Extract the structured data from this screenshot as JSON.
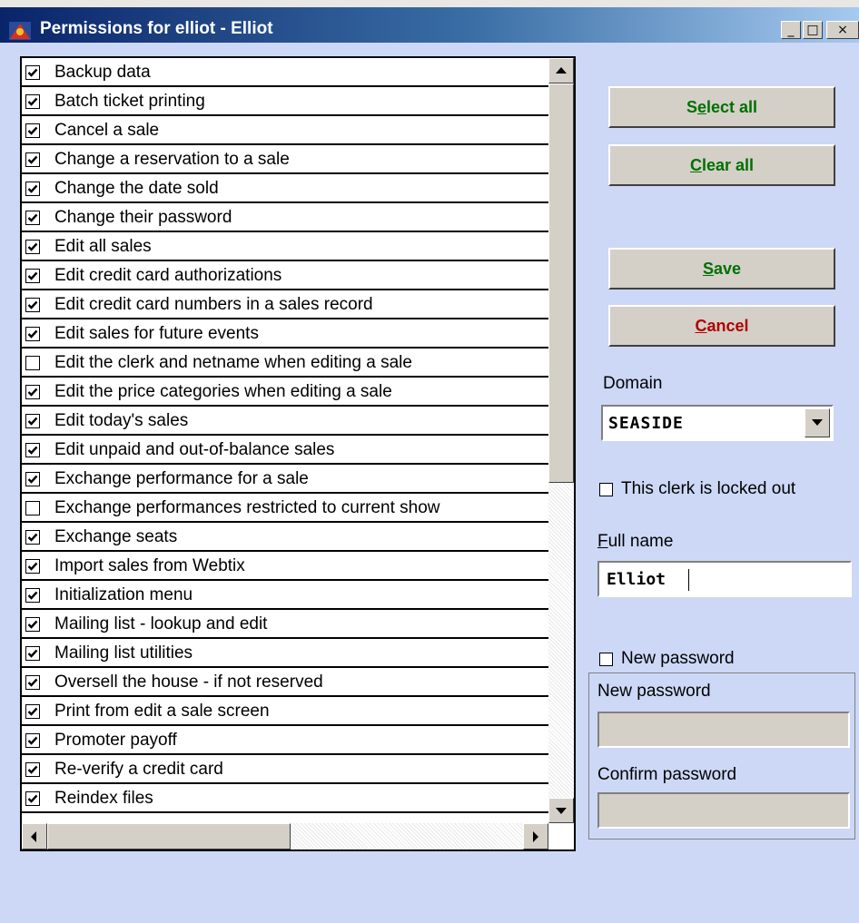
{
  "window": {
    "title": "Permissions for elliot - Elliot",
    "minimize_glyph": "_",
    "maximize_glyph": "□",
    "close_glyph": "×"
  },
  "permissions": [
    {
      "label": "Backup data",
      "checked": true
    },
    {
      "label": "Batch ticket printing",
      "checked": true
    },
    {
      "label": "Cancel a sale",
      "checked": true
    },
    {
      "label": "Change a reservation to a sale",
      "checked": true
    },
    {
      "label": "Change the date sold",
      "checked": true
    },
    {
      "label": "Change their password",
      "checked": true
    },
    {
      "label": "Edit all sales",
      "checked": true
    },
    {
      "label": "Edit credit card authorizations",
      "checked": true
    },
    {
      "label": "Edit credit card numbers in a sales record",
      "checked": true
    },
    {
      "label": "Edit sales for future events",
      "checked": true
    },
    {
      "label": "Edit the clerk and netname when editing a sale",
      "checked": false
    },
    {
      "label": "Edit the price categories when editing a sale",
      "checked": true
    },
    {
      "label": "Edit today's sales",
      "checked": true
    },
    {
      "label": "Edit unpaid and out-of-balance sales",
      "checked": true
    },
    {
      "label": "Exchange performance for a sale",
      "checked": true
    },
    {
      "label": "Exchange performances restricted to current show",
      "checked": false
    },
    {
      "label": "Exchange seats",
      "checked": true
    },
    {
      "label": "Import sales from Webtix",
      "checked": true
    },
    {
      "label": "Initialization menu",
      "checked": true
    },
    {
      "label": "Mailing list - lookup and edit",
      "checked": true
    },
    {
      "label": "Mailing list utilities",
      "checked": true
    },
    {
      "label": "Oversell the house - if not reserved",
      "checked": true
    },
    {
      "label": "Print from edit a sale screen",
      "checked": true
    },
    {
      "label": "Promoter payoff",
      "checked": true
    },
    {
      "label": "Re-verify a credit card",
      "checked": true
    },
    {
      "label": "Reindex files",
      "checked": true
    }
  ],
  "buttons": {
    "select_all": {
      "pre": "S",
      "key": "e",
      "post": "lect all"
    },
    "clear_all": {
      "pre": "",
      "key": "C",
      "post": "lear all"
    },
    "save": {
      "pre": "",
      "key": "S",
      "post": "ave"
    },
    "cancel": {
      "pre": "",
      "key": "C",
      "post": "ancel"
    }
  },
  "domain": {
    "label": "Domain",
    "value": "SEASIDE"
  },
  "locked_out": {
    "label": "This clerk is locked out",
    "checked": false
  },
  "full_name": {
    "label_key": "F",
    "label_rest": "ull name",
    "value": "Elliot"
  },
  "new_password_toggle": {
    "label": "New password",
    "checked": false
  },
  "password_group": {
    "new_label": "New password",
    "confirm_label": "Confirm password",
    "new_value": "",
    "confirm_value": ""
  },
  "colors": {
    "background": "#ccd8f6",
    "title_start": "#0a246a",
    "title_end": "#a6caf0",
    "green_text": "#007000",
    "red_text": "#b00000"
  }
}
